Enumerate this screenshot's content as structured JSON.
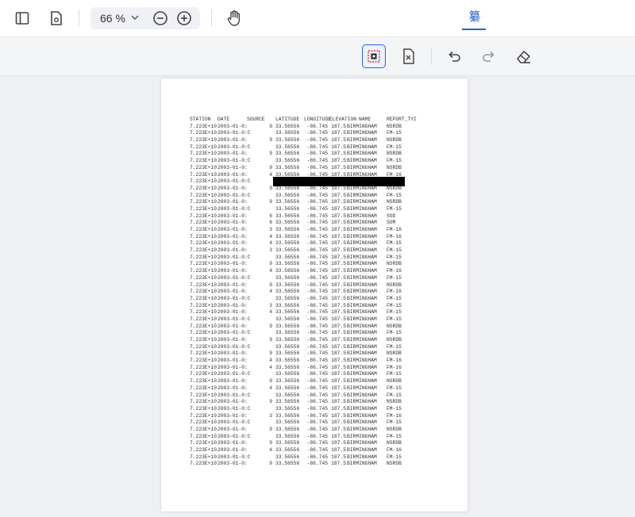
{
  "toolbar": {
    "zoom_value": "66",
    "zoom_unit": "%",
    "tab_label": "纂"
  },
  "document": {
    "headers": [
      "STATION",
      "DATE",
      "SOURCE",
      "LATITUDE",
      "LONGITUDE",
      "ELEVATION",
      "NAME",
      "REPORT_TYI"
    ],
    "rows": [
      [
        "7.223E+10",
        "2003-01-0:",
        "9",
        "33.56556",
        "-86.745",
        "187.5",
        "BIRMINGHAM",
        "NSRDB"
      ],
      [
        "7.223E+10",
        "2003-01-0:C",
        "",
        "33.56556",
        "-86.745",
        "187.5",
        "BIRMINGHAM",
        "FM-15"
      ],
      [
        "7.223E+10",
        "2003-01-0:",
        "9",
        "33.56556",
        "-86.745",
        "187.5",
        "BIRMINGHAM",
        "NSRDB"
      ],
      [
        "7.223E+10",
        "2003-01-0:C",
        "",
        "33.56556",
        "-86.745",
        "187.5",
        "BIRMINGHAM",
        "FM-15"
      ],
      [
        "7.223E+10",
        "2003-01-0:",
        "9",
        "33.56556",
        "-86.745",
        "187.5",
        "BIRMINGHAM",
        "NSRDB"
      ],
      [
        "7.223E+10",
        "2003-01-0:C",
        "",
        "33.56556",
        "-86.745",
        "187.5",
        "BIRMINGHAM",
        "FM-15"
      ],
      [
        "7.223E+10",
        "2003-01-0:",
        "9",
        "33.56556",
        "-86.745",
        "187.5",
        "BIRMINGHAM",
        "NSRDB"
      ],
      [
        "7.223E+10",
        "2003-01-0:",
        "4",
        "33.56556",
        "-86.745",
        "187.5",
        "BIRMINGHAM",
        "FM-16"
      ],
      [
        "7.223E+10",
        "2003-01-0:C",
        "",
        "",
        "",
        "",
        "",
        ""
      ],
      [
        "7.223E+10",
        "2003-01-0:",
        "9",
        "33.56556",
        "-86.745",
        "187.5",
        "BIRMINGHAM",
        "NSRDB"
      ],
      [
        "7.223E+10",
        "2003-01-0:C",
        "",
        "33.56556",
        "-86.745",
        "187.5",
        "BIRMINGHAM",
        "FM-15"
      ],
      [
        "7.223E+10",
        "2003-01-0:",
        "9",
        "33.56556",
        "-86.745",
        "187.5",
        "BIRMINGHAM",
        "NSRDB"
      ],
      [
        "7.223E+10",
        "2003-01-0:C",
        "",
        "33.56556",
        "-86.745",
        "187.5",
        "BIRMINGHAM",
        "FM-15"
      ],
      [
        "7.223E+10",
        "2003-01-0:",
        "6",
        "33.56556",
        "-86.745",
        "187.5",
        "BIRMINGHAM",
        "SOD"
      ],
      [
        "7.223E+10",
        "2003-01-0:",
        "6",
        "33.56556",
        "-86.745",
        "187.5",
        "BIRMINGHAM",
        "SOM"
      ],
      [
        "7.223E+10",
        "2003-01-0:",
        "3",
        "33.56556",
        "-86.745",
        "187.5",
        "BIRMINGHAM",
        "FM-16"
      ],
      [
        "7.223E+10",
        "2003-01-0:",
        "4",
        "33.56556",
        "-86.745",
        "187.5",
        "BIRMINGHAM",
        "FM-16"
      ],
      [
        "7.223E+10",
        "2003-01-0:",
        "4",
        "33.56556",
        "-86.745",
        "187.5",
        "BIRMINGHAM",
        "FM-15"
      ],
      [
        "7.223E+10",
        "2003-01-0:",
        "3",
        "33.56556",
        "-86.745",
        "187.5",
        "BIRMINGHAM",
        "FM-15"
      ],
      [
        "7.223E+10",
        "2003-01-0:C",
        "",
        "33.56556",
        "-86.745",
        "187.5",
        "BIRMINGHAM",
        "FM-15"
      ],
      [
        "7.223E+10",
        "2003-01-0:",
        "9",
        "33.56556",
        "-86.745",
        "187.5",
        "BIRMINGHAM",
        "NSRDB"
      ],
      [
        "7.223E+10",
        "2003-01-0:",
        "4",
        "33.56556",
        "-86.745",
        "187.5",
        "BIRMINGHAM",
        "FM-16"
      ],
      [
        "7.223E+10",
        "2003-01-0:C",
        "",
        "33.56556",
        "-86.745",
        "187.5",
        "BIRMINGHAM",
        "FM-15"
      ],
      [
        "7.223E+10",
        "2003-01-0:",
        "9",
        "33.56556",
        "-86.745",
        "187.5",
        "BIRMINGHAM",
        "NSRDB"
      ],
      [
        "7.223E+10",
        "2003-01-0:",
        "4",
        "33.56556",
        "-86.745",
        "187.5",
        "BIRMINGHAM",
        "FM-16"
      ],
      [
        "7.223E+10",
        "2003-01-0:C",
        "",
        "33.56556",
        "-86.745",
        "187.5",
        "BIRMINGHAM",
        "FM-15"
      ],
      [
        "7.223E+10",
        "2003-01-0:",
        "3",
        "33.56556",
        "-86.745",
        "187.5",
        "BIRMINGHAM",
        "FM-15"
      ],
      [
        "7.223E+10",
        "2003-01-0:",
        "4",
        "33.56556",
        "-86.745",
        "187.5",
        "BIRMINGHAM",
        "FM-15"
      ],
      [
        "7.223E+10",
        "2003-01-0:C",
        "",
        "33.56556",
        "-86.745",
        "187.5",
        "BIRMINGHAM",
        "FM-15"
      ],
      [
        "7.223E+10",
        "2003-01-0:",
        "9",
        "33.56556",
        "-86.745",
        "187.5",
        "BIRMINGHAM",
        "NSRDB"
      ],
      [
        "7.223E+10",
        "2003-01-0:C",
        "",
        "33.56556",
        "-86.745",
        "187.5",
        "BIRMINGHAM",
        "FM-15"
      ],
      [
        "7.223E+10",
        "2003-01-0:",
        "9",
        "33.56556",
        "-86.745",
        "187.5",
        "BIRMINGHAM",
        "NSRDB"
      ],
      [
        "7.223E+10",
        "2003-01-0:C",
        "",
        "33.56556",
        "-86.745",
        "187.5",
        "BIRMINGHAM",
        "FM-15"
      ],
      [
        "7.223E+10",
        "2003-01-0:",
        "9",
        "33.56556",
        "-86.745",
        "187.5",
        "BIRMINGHAM",
        "NSRDB"
      ],
      [
        "7.223E+10",
        "2003-01-0:",
        "4",
        "33.56556",
        "-86.745",
        "187.5",
        "BIRMINGHAM",
        "FM-16"
      ],
      [
        "7.223E+10",
        "2003-01-0:",
        "4",
        "33.56556",
        "-86.745",
        "187.5",
        "BIRMINGHAM",
        "FM-16"
      ],
      [
        "7.223E+10",
        "2003-01-0:C",
        "",
        "33.56556",
        "-86.745",
        "187.5",
        "BIRMINGHAM",
        "FM-15"
      ],
      [
        "7.223E+10",
        "2003-01-0:",
        "9",
        "33.56556",
        "-86.745",
        "187.5",
        "BIRMINGHAM",
        "NSRDB"
      ],
      [
        "7.223E+10",
        "2003-01-0:",
        "4",
        "33.56556",
        "-86.745",
        "187.5",
        "BIRMINGHAM",
        "FM-15"
      ],
      [
        "7.223E+10",
        "2003-01-0:C",
        "",
        "33.56556",
        "-86.745",
        "187.5",
        "BIRMINGHAM",
        "FM-15"
      ],
      [
        "7.223E+10",
        "2003-01-0:",
        "9",
        "33.56556",
        "-86.745",
        "187.5",
        "BIRMINGHAM",
        "NSRDB"
      ],
      [
        "7.223E+10",
        "2003-01-0:C",
        "",
        "33.56556",
        "-86.745",
        "187.5",
        "BIRMINGHAM",
        "FM-15"
      ],
      [
        "7.223E+10",
        "2003-01-0:",
        "3",
        "33.56556",
        "-86.745",
        "187.5",
        "BIRMINGHAM",
        "FM-16"
      ],
      [
        "7.223E+10",
        "2003-01-0:C",
        "",
        "33.56556",
        "-86.745",
        "187.5",
        "BIRMINGHAM",
        "FM-15"
      ],
      [
        "7.223E+10",
        "2003-01-0:",
        "9",
        "33.56556",
        "-86.745",
        "187.5",
        "BIRMINGHAM",
        "NSRDB"
      ],
      [
        "7.223E+10",
        "2003-01-0:C",
        "",
        "33.56556",
        "-86.745",
        "187.5",
        "BIRMINGHAM",
        "FM-15"
      ],
      [
        "7.223E+10",
        "2003-01-0:",
        "9",
        "33.56556",
        "-86.745",
        "187.5",
        "BIRMINGHAM",
        "NSRDB"
      ],
      [
        "7.223E+10",
        "2003-01-0:",
        "4",
        "33.56556",
        "-86.745",
        "187.5",
        "BIRMINGHAM",
        "FM-16"
      ],
      [
        "7.223E+10",
        "2003-01-0:C",
        "",
        "33.56556",
        "-86.745",
        "187.5",
        "BIRMINGHAM",
        "FM-15"
      ],
      [
        "7.223E+10",
        "2003-01-0:",
        "9",
        "33.56556",
        "-86.745",
        "187.5",
        "BIRMINGHAM",
        "NSRDB"
      ]
    ]
  }
}
